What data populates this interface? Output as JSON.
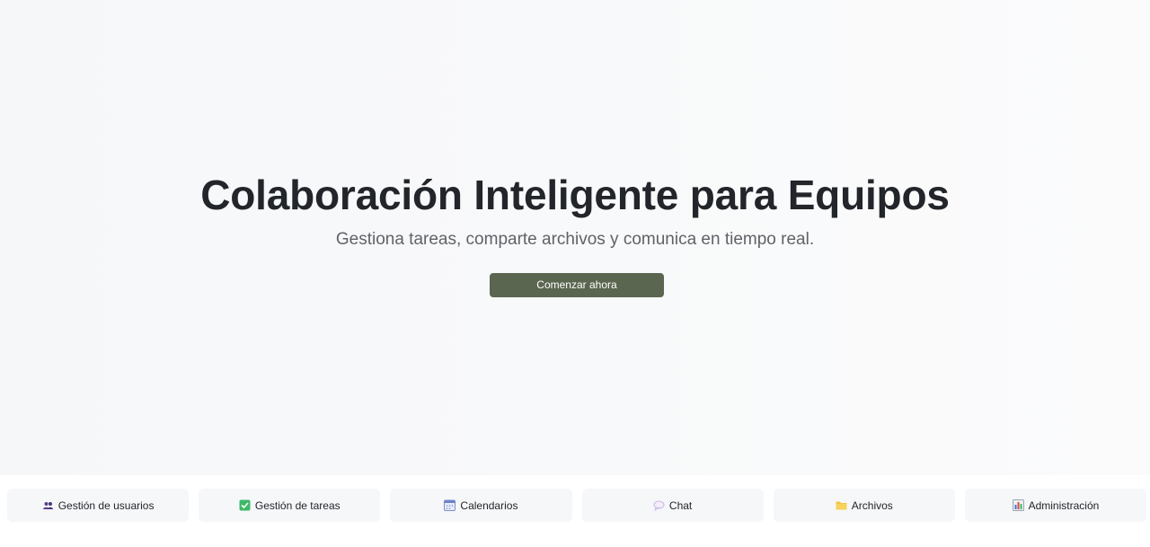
{
  "hero": {
    "title": "Colaboración Inteligente para Equipos",
    "subtitle": "Gestiona tareas, comparte archivos y comunica en tiempo real.",
    "cta_label": "Comenzar ahora"
  },
  "features": [
    {
      "label": "Gestión de usuarios",
      "icon": "users-icon"
    },
    {
      "label": "Gestión de tareas",
      "icon": "checkbox-icon"
    },
    {
      "label": "Calendarios",
      "icon": "calendar-icon"
    },
    {
      "label": "Chat",
      "icon": "speech-bubble-icon"
    },
    {
      "label": "Archivos",
      "icon": "folder-icon"
    },
    {
      "label": "Administración",
      "icon": "bar-chart-icon"
    }
  ],
  "colors": {
    "cta_background": "#5b6650",
    "title_text": "#22252a",
    "subtitle_text": "#5f6368",
    "card_background": "#f6f7f9"
  }
}
